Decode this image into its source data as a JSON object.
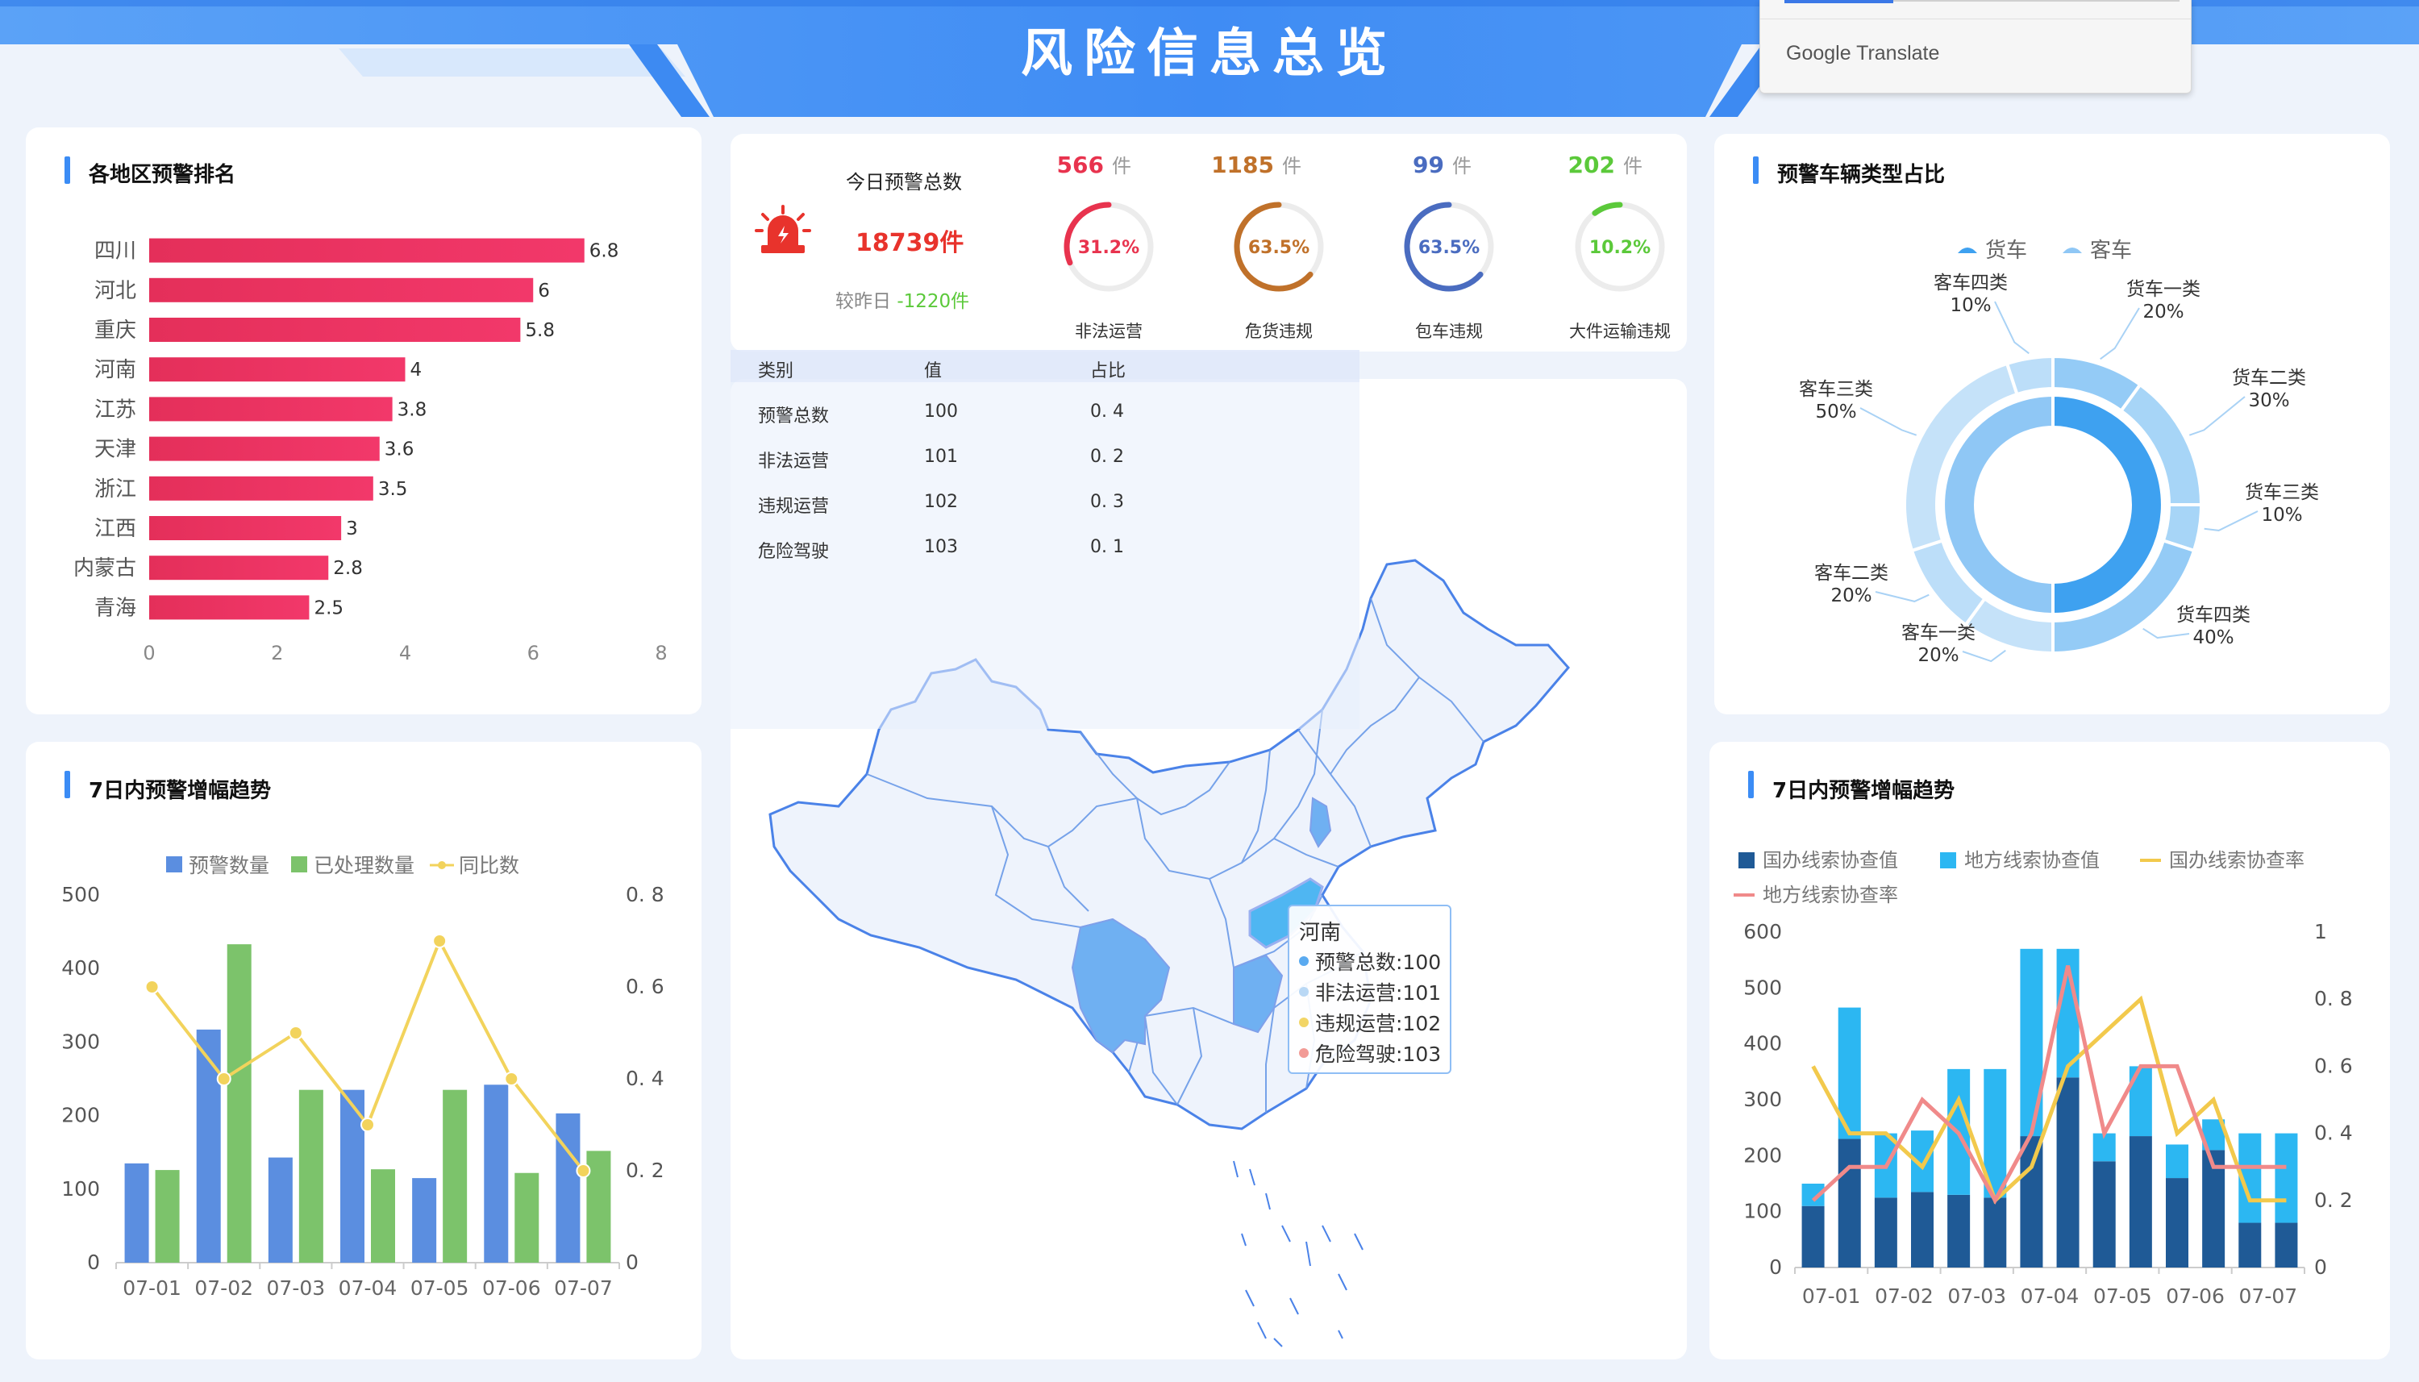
{
  "header": {
    "title": "风险信息总览"
  },
  "translate_popup": {
    "label": "Google Translate"
  },
  "region_ranking": {
    "title": "各地区预警排名",
    "chart_data": {
      "type": "bar",
      "orientation": "horizontal",
      "categories": [
        "四川",
        "河北",
        "重庆",
        "河南",
        "江苏",
        "天津",
        "浙江",
        "江西",
        "内蒙古",
        "青海"
      ],
      "values": [
        6.8,
        6,
        5.8,
        4,
        3.8,
        3.6,
        3.5,
        3,
        2.8,
        2.5
      ],
      "xlim": [
        0,
        8
      ],
      "x_ticks": [
        "0",
        "2",
        "4",
        "6",
        "8"
      ],
      "color": "#ea3463"
    }
  },
  "kpi": {
    "today_label": "今日预警总数",
    "today_value": "18739件",
    "compare_label": "较昨日",
    "compare_value": "-1220件",
    "gauges": [
      {
        "count": "566",
        "unit": "件",
        "percent": "31.2%",
        "fraction": 0.312,
        "label": "非法运营",
        "color": "#e8334e"
      },
      {
        "count": "1185",
        "unit": "件",
        "percent": "63.5%",
        "fraction": 0.635,
        "label": "危货违规",
        "color": "#c0712a"
      },
      {
        "count": "99",
        "unit": "件",
        "percent": "63.5%",
        "fraction": 0.635,
        "label": "包车违规",
        "color": "#4a6cc0"
      },
      {
        "count": "202",
        "unit": "件",
        "percent": "10.2%",
        "fraction": 0.102,
        "label": "大件运输违规",
        "color": "#5bc93a"
      }
    ]
  },
  "data_table": {
    "headers": [
      "类别",
      "值",
      "占比"
    ],
    "rows": [
      [
        "预警总数",
        "100",
        "0. 4"
      ],
      [
        "非法运营",
        "101",
        "0. 2"
      ],
      [
        "违规运营",
        "102",
        "0. 3"
      ],
      [
        "危险驾驶",
        "103",
        "0. 1"
      ]
    ]
  },
  "map_tooltip": {
    "title": "河南",
    "rows": [
      {
        "text": "预警总数:100",
        "color": "#5aaaf0"
      },
      {
        "text": "非法运营:101",
        "color": "#b9d8f5"
      },
      {
        "text": "违规运营:102",
        "color": "#f2d566"
      },
      {
        "text": "危险驾驶:103",
        "color": "#f29b96"
      }
    ]
  },
  "vehicle_type": {
    "title": "预警车辆类型占比",
    "chart_data": {
      "type": "pie",
      "legend": [
        "货车",
        "客车"
      ],
      "inner_ring": [
        {
          "name": "货车",
          "value": 50,
          "color": "#3ea1f0"
        },
        {
          "name": "客车",
          "value": 50,
          "color": "#8fc7f5"
        }
      ],
      "outer_ring": [
        {
          "name": "货车一类",
          "label": "20%",
          "value": 20,
          "color": "#94cbf6"
        },
        {
          "name": "货车二类",
          "label": "30%",
          "value": 30,
          "color": "#a7d5f7"
        },
        {
          "name": "货车三类",
          "label": "10%",
          "value": 10,
          "color": "#a7d5f7"
        },
        {
          "name": "货车四类",
          "label": "40%",
          "value": 40,
          "color": "#94cbf6"
        },
        {
          "name": "客车一类",
          "label": "20%",
          "value": 20,
          "color": "#c5e2f9"
        },
        {
          "name": "客车二类",
          "label": "20%",
          "value": 20,
          "color": "#bcdef9"
        },
        {
          "name": "客车三类",
          "label": "50%",
          "value": 50,
          "color": "#c5e2f9"
        },
        {
          "name": "客车四类",
          "label": "10%",
          "value": 10,
          "color": "#bcdef9"
        }
      ]
    }
  },
  "trend_left": {
    "title": "7日内预警增幅趋势",
    "chart_data": {
      "type": "bar",
      "categories": [
        "07-01",
        "07-02",
        "07-03",
        "07-04",
        "07-05",
        "07-06",
        "07-07"
      ],
      "series": [
        {
          "name": "预警数量",
          "type": "bar",
          "values": [
            135,
            317,
            143,
            235,
            115,
            242,
            203
          ],
          "color": "#5b8ee0"
        },
        {
          "name": "已处理数量",
          "type": "bar",
          "values": [
            126,
            433,
            235,
            127,
            235,
            122,
            152
          ],
          "color": "#7cc36b"
        },
        {
          "name": "同比数",
          "type": "line",
          "axis": "right",
          "values": [
            0.6,
            0.4,
            0.5,
            0.3,
            0.7,
            0.4,
            0.2
          ],
          "color": "#f2d35c"
        }
      ],
      "ylim": [
        0,
        500
      ],
      "y_ticks": [
        "0",
        "100",
        "200",
        "300",
        "400",
        "500"
      ],
      "y2lim": [
        0,
        0.8
      ],
      "y2_ticks": [
        "0",
        "0. 2",
        "0. 4",
        "0. 6",
        "0. 8"
      ]
    }
  },
  "trend_right": {
    "title": "7日内预警增幅趋势",
    "chart_data": {
      "type": "bar",
      "stacked": true,
      "categories": [
        "07-01",
        "07-02",
        "07-03",
        "07-04",
        "07-05",
        "07-06",
        "07-07"
      ],
      "bar_values_total": [
        150,
        465,
        240,
        245,
        355,
        355,
        570,
        570,
        240,
        360,
        220,
        265,
        240,
        240
      ],
      "series": [
        {
          "name": "国办线索协查值",
          "type": "bar",
          "values": [
            110,
            230,
            125,
            135,
            130,
            125,
            235,
            340,
            190,
            235,
            160,
            210,
            80,
            80
          ],
          "color": "#1f5a96"
        },
        {
          "name": "地方线索协查值",
          "type": "bar",
          "values": [
            40,
            235,
            115,
            110,
            225,
            230,
            335,
            230,
            50,
            125,
            60,
            55,
            160,
            160
          ],
          "color": "#2cb7f2"
        },
        {
          "name": "国办线索协查率",
          "type": "line",
          "axis": "right",
          "values": [
            0.6,
            0.4,
            0.4,
            0.3,
            0.5,
            0.2,
            0.3,
            0.6,
            0.7,
            0.8,
            0.4,
            0.5,
            0.2,
            0.2
          ],
          "color": "#f2c94c"
        },
        {
          "name": "地方线索协查率",
          "type": "line",
          "axis": "right",
          "values": [
            0.2,
            0.3,
            0.3,
            0.5,
            0.4,
            0.2,
            0.4,
            0.9,
            0.4,
            0.6,
            0.6,
            0.3,
            0.3,
            0.3
          ],
          "color": "#f08a8a"
        }
      ],
      "ylim": [
        0,
        600
      ],
      "y_ticks": [
        "0",
        "100",
        "200",
        "300",
        "400",
        "500",
        "600"
      ],
      "y2lim": [
        0,
        1
      ],
      "y2_ticks": [
        "0",
        "0. 2",
        "0. 4",
        "0. 6",
        "0. 8",
        "1"
      ]
    }
  }
}
